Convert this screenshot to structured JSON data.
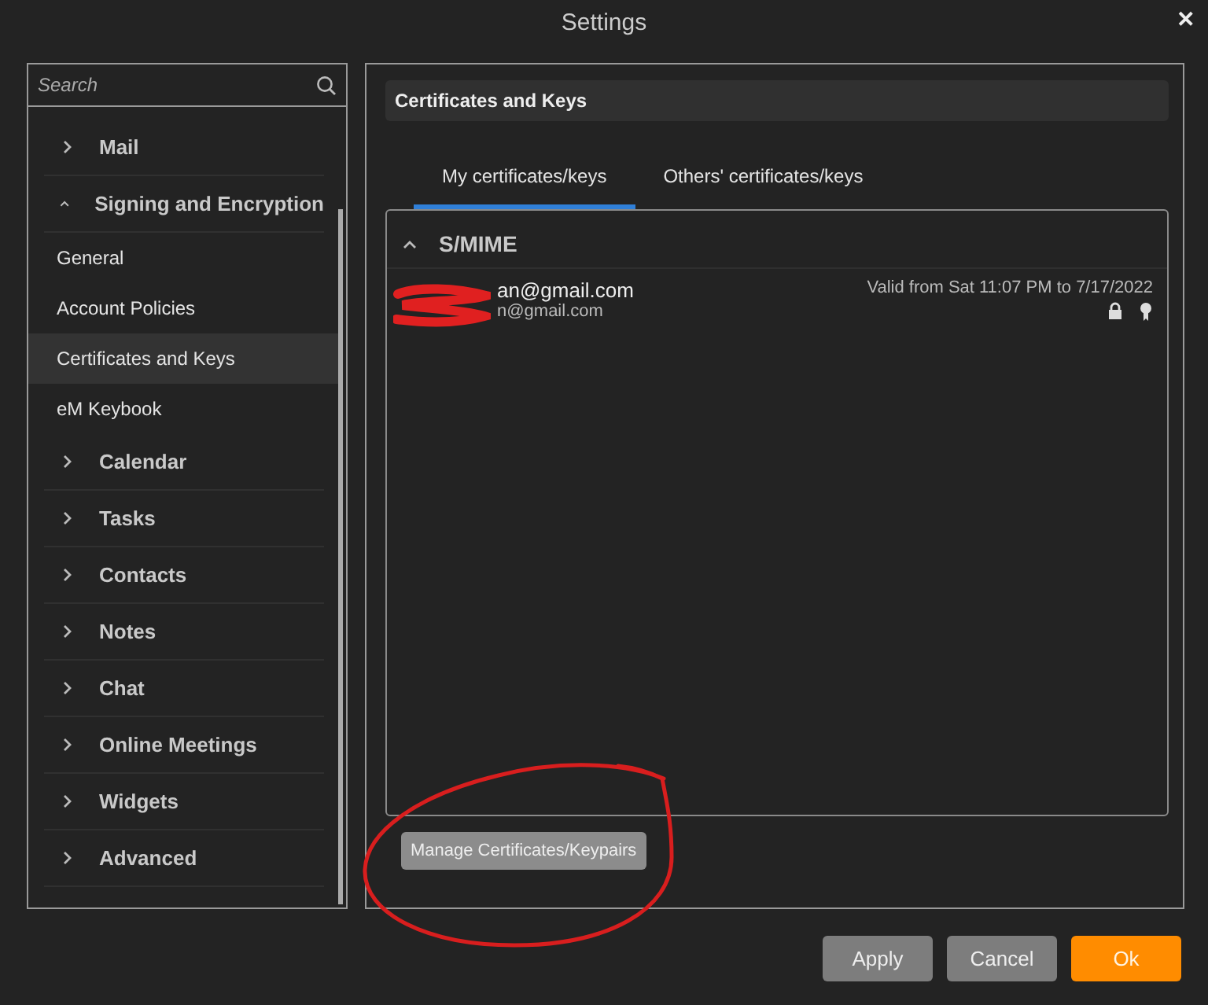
{
  "window": {
    "title": "Settings",
    "close": "✕"
  },
  "sidebar": {
    "search": {
      "placeholder": "Search"
    },
    "items": [
      {
        "label": "Mail",
        "expanded": false
      },
      {
        "label": "Signing and Encryption",
        "expanded": true,
        "children": [
          {
            "label": "General",
            "selected": false
          },
          {
            "label": "Account Policies",
            "selected": false
          },
          {
            "label": "Certificates and Keys",
            "selected": true
          },
          {
            "label": "eM Keybook",
            "selected": false
          }
        ]
      },
      {
        "label": "Calendar",
        "expanded": false
      },
      {
        "label": "Tasks",
        "expanded": false
      },
      {
        "label": "Contacts",
        "expanded": false
      },
      {
        "label": "Notes",
        "expanded": false
      },
      {
        "label": "Chat",
        "expanded": false
      },
      {
        "label": "Online Meetings",
        "expanded": false
      },
      {
        "label": "Widgets",
        "expanded": false
      },
      {
        "label": "Advanced",
        "expanded": false
      }
    ]
  },
  "content": {
    "header": "Certificates and Keys",
    "tabs": [
      {
        "label": "My certificates/keys",
        "selected": true
      },
      {
        "label": "Others' certificates/keys",
        "selected": false
      }
    ],
    "group": {
      "title": "S/MIME",
      "expanded": true,
      "certificates": [
        {
          "name": "an@gmail.com",
          "email": "n@gmail.com",
          "validity": "Valid from Sat 11:07 PM to 7/17/2022",
          "redacted": true
        }
      ]
    },
    "manage_button": "Manage Certificates/Keypairs"
  },
  "buttons": [
    {
      "label": "Apply",
      "kind": "secondary"
    },
    {
      "label": "Cancel",
      "kind": "secondary"
    },
    {
      "label": "Ok",
      "kind": "primary"
    }
  ],
  "annotation": {
    "kind": "circle"
  }
}
